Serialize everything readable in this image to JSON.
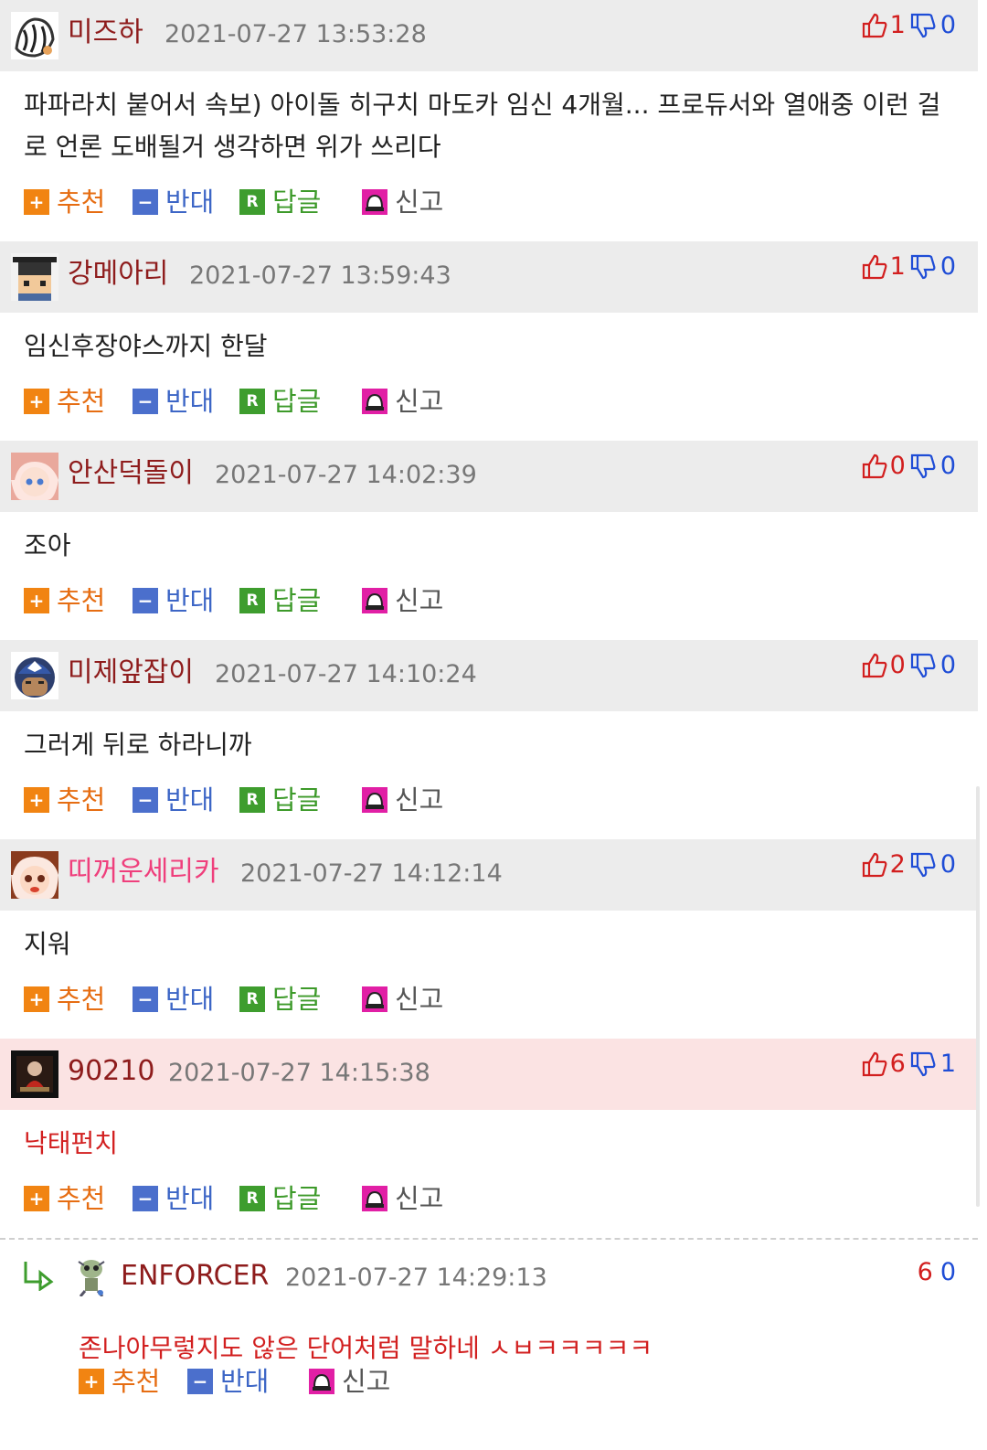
{
  "comments": [
    {
      "nick": "미즈하",
      "date": "2021-07-27 13:53:28",
      "up": "1",
      "down": "0",
      "text": "파파라치 붙어서 속보) 아이돌 히구치 마도카 임신 4개월... 프로듀서와 열애중 이런 걸로 언론 도배될거 생각하면 위가 쓰리다"
    },
    {
      "nick": "강메아리",
      "date": "2021-07-27 13:59:43",
      "up": "1",
      "down": "0",
      "text": "임신후장야스까지 한달"
    },
    {
      "nick": "안산덕돌이",
      "date": "2021-07-27 14:02:39",
      "up": "0",
      "down": "0",
      "text": "조아"
    },
    {
      "nick": "미제앞잡이",
      "date": "2021-07-27 14:10:24",
      "up": "0",
      "down": "0",
      "text": "그러게 뒤로 하라니까"
    },
    {
      "nick": "띠꺼운세리카",
      "date": "2021-07-27 14:12:14",
      "up": "2",
      "down": "0",
      "text": "지워"
    },
    {
      "nick": "90210",
      "date": "2021-07-27 14:15:38",
      "up": "6",
      "down": "1",
      "text": "낙태펀치"
    }
  ],
  "reply": {
    "nick": "ENFORCER",
    "date": "2021-07-27 14:29:13",
    "up": "6",
    "down": "0",
    "text": "존나아무렇지도 않은 단어처럼 말하네 ㅅㅂㅋㅋㅋㅋㅋ"
  },
  "actions": {
    "recommend": "추천",
    "oppose": "반대",
    "reply": "답글",
    "report": "신고"
  },
  "icons": {
    "recommend": "plus-icon",
    "oppose": "minus-icon",
    "reply": "r-icon",
    "report": "siren-icon",
    "up": "thumbs-up-icon",
    "down": "thumbs-down-icon"
  },
  "colors": {
    "nick": "#8e1c1c",
    "nick_pink": "#ef3f7c",
    "header_bg": "#ececec",
    "highlight_bg": "#fbe3e3",
    "up": "#d21f1f",
    "down": "#1f4dd6",
    "recommend": "#f18412",
    "oppose": "#4b6fcc",
    "reply": "#3e9d2e"
  }
}
